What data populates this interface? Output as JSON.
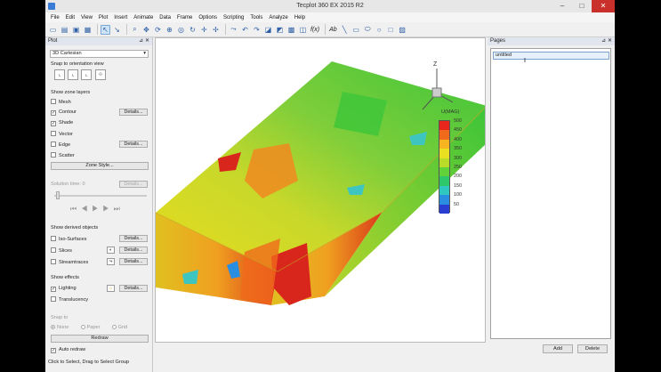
{
  "window": {
    "title": "Tecplot 360 EX 2015 R2",
    "min": "–",
    "max": "□",
    "close": "✕"
  },
  "menu": [
    "File",
    "Edit",
    "View",
    "Plot",
    "Insert",
    "Animate",
    "Data",
    "Frame",
    "Options",
    "Scripting",
    "Tools",
    "Analyze",
    "Help"
  ],
  "toolbar": {
    "text_tool": "Ab",
    "formula_tool": "f(x)"
  },
  "plot_panel": {
    "title": "Plot",
    "plot_type": "3D Cartesian",
    "snap_label": "Snap to orientation view",
    "zone_layers_label": "Show zone layers",
    "layers": [
      {
        "label": "Mesh",
        "checked": false
      },
      {
        "label": "Contour",
        "checked": true,
        "details": "Details..."
      },
      {
        "label": "Shade",
        "checked": true
      },
      {
        "label": "Vector",
        "checked": false
      },
      {
        "label": "Edge",
        "checked": false,
        "details": "Details..."
      },
      {
        "label": "Scatter",
        "checked": false
      }
    ],
    "zone_style": "Zone Style...",
    "solution_time_label": "Solution time: 0",
    "solution_details": "Details...",
    "derived_label": "Show derived objects",
    "derived": [
      {
        "label": "Iso-Surfaces",
        "details": "Details..."
      },
      {
        "label": "Slices",
        "details": "Details..."
      },
      {
        "label": "Streamtraces",
        "details": "Details..."
      }
    ],
    "effects_label": "Show effects",
    "effects": [
      {
        "label": "Lighting",
        "checked": true,
        "details": "Details..."
      },
      {
        "label": "Translucency",
        "checked": false
      }
    ],
    "snap_to_label": "Snap to",
    "snap_options": [
      "None",
      "Paper",
      "Grid"
    ],
    "redraw": "Redraw",
    "auto_redraw": "Auto redraw"
  },
  "statusbar": "Click to Select, Drag to Select Group",
  "viewport": {
    "axis_label": "Z",
    "colors": {
      "red": "#d8261c",
      "orange": "#f08a20",
      "yellow": "#e8dc1e",
      "lightgreen": "#9fd33a",
      "green": "#3cc53a",
      "cyan": "#3ec5c0",
      "blue": "#2a3fd1"
    }
  },
  "legend": {
    "title": "U(MAG)",
    "levels": [
      "500",
      "450",
      "400",
      "350",
      "300",
      "250",
      "200",
      "150",
      "100",
      "50"
    ],
    "colors": [
      "#e8261c",
      "#f06a1c",
      "#f6b420",
      "#e8e020",
      "#b8dc28",
      "#62d23a",
      "#2ec86a",
      "#2ec8c0",
      "#2a8ee0",
      "#2a3fd1"
    ]
  },
  "pages_panel": {
    "title": "Pages",
    "page_name": "untitled",
    "add": "Add",
    "delete": "Delete"
  }
}
